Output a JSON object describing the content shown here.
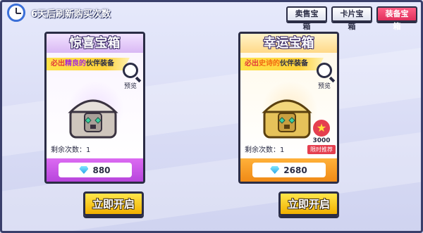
{
  "refresh": {
    "text": "6天后刷新购买次数",
    "icon": "alarm-clock-icon"
  },
  "tabs": [
    {
      "label": "卖售宝箱",
      "active": false
    },
    {
      "label": "卡片宝箱",
      "active": false
    },
    {
      "label": "装备宝箱",
      "active": true
    }
  ],
  "cards": [
    {
      "title": "惊喜宝箱",
      "banner": {
        "prefix": "必出",
        "highlight": "精良的",
        "suffix": "伙伴装备"
      },
      "preview_label": "预览",
      "chest_color": "silver",
      "remaining": "剩余次数：1",
      "price": "880",
      "currency_icon": "diamond-icon",
      "accent_color": "#c257e6",
      "button_label": "立即开启"
    },
    {
      "title": "幸运宝箱",
      "banner": {
        "prefix": "必出",
        "highlight": "史诗的",
        "suffix": "伙伴装备"
      },
      "preview_label": "预览",
      "chest_color": "gold",
      "remaining": "剩余次数：1",
      "limited": {
        "count": "3000",
        "label": "限时推荐"
      },
      "price": "2680",
      "currency_icon": "diamond-icon",
      "accent_color": "#f4a024",
      "button_label": "立即开启"
    }
  ]
}
